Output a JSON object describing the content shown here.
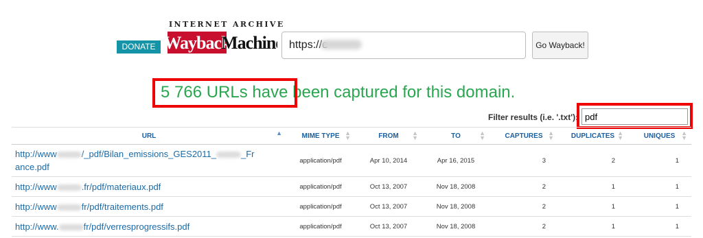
{
  "header": {
    "donate_label": "DONATE",
    "brand_top": "INTERNET ARCHIVE",
    "brand_wayback": "Wayback",
    "brand_machine": "Machine",
    "url_value": "https://e",
    "go_label": "Go Wayback!"
  },
  "headline": "5 766 URLs have been captured for this domain.",
  "filter": {
    "label": "Filter results (i.e. '.txt'):",
    "value": "pdf"
  },
  "table": {
    "headers": [
      "URL",
      "MIME TYPE",
      "FROM",
      "TO",
      "CAPTURES",
      "DUPLICATES",
      "UNIQUES"
    ],
    "rows": [
      {
        "url_a": "http://www",
        "url_b": "/_pdf/Bilan_emissions_GES2011_",
        "url_c": "_Fr",
        "url_d": "ance.pdf",
        "mime": "application/pdf",
        "from": "Apr 10, 2014",
        "to": "Apr 16, 2015",
        "captures": "3",
        "duplicates": "2",
        "uniques": "1"
      },
      {
        "url_a": "http://www",
        "url_b": ".fr/pdf/materiaux.pdf",
        "mime": "application/pdf",
        "from": "Oct 13, 2007",
        "to": "Nov 18, 2008",
        "captures": "2",
        "duplicates": "1",
        "uniques": "1"
      },
      {
        "url_a": "http://www",
        "url_b": "fr/pdf/traitements.pdf",
        "mime": "application/pdf",
        "from": "Oct 13, 2007",
        "to": "Nov 18, 2008",
        "captures": "2",
        "duplicates": "1",
        "uniques": "1"
      },
      {
        "url_a": "http://www.",
        "url_b": "fr/pdf/verresprogressifs.pdf",
        "mime": "application/pdf",
        "from": "Oct 13, 2007",
        "to": "Nov 18, 2008",
        "captures": "2",
        "duplicates": "1",
        "uniques": "1"
      }
    ]
  }
}
